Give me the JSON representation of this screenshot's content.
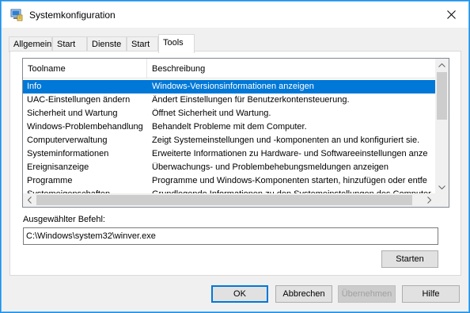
{
  "window": {
    "title": "Systemkonfiguration",
    "accent_color": "#0078d7"
  },
  "tabs": [
    {
      "label": "Allgemein"
    },
    {
      "label": "Start"
    },
    {
      "label": "Dienste"
    },
    {
      "label": "Start"
    },
    {
      "label": "Tools",
      "active": true
    }
  ],
  "tools_list": {
    "columns": [
      "Toolname",
      "Beschreibung"
    ],
    "rows": [
      {
        "name": "Info",
        "description": "Windows-Versionsinformationen anzeigen",
        "selected": true
      },
      {
        "name": "UAC-Einstellungen ändern",
        "description": "Ändert Einstellungen für Benutzerkontensteuerung."
      },
      {
        "name": "Sicherheit und Wartung",
        "description": "Öffnet Sicherheit und Wartung."
      },
      {
        "name": "Windows-Problembehandlung",
        "description": "Behandelt Probleme mit dem Computer."
      },
      {
        "name": "Computerverwaltung",
        "description": "Zeigt Systemeinstellungen und -komponenten an und konfiguriert sie."
      },
      {
        "name": "Systeminformationen",
        "description": "Erweiterte Informationen zu Hardware- und Softwareeinstellungen anze"
      },
      {
        "name": "Ereignisanzeige",
        "description": "Überwachungs- und Problembehebungsmeldungen anzeigen"
      },
      {
        "name": "Programme",
        "description": "Programme und Windows-Komponenten starten, hinzufügen oder entfe"
      },
      {
        "name": "Systemeigenschaften",
        "description": "Grundlegende Informationen zu den Systemeinstellungen des Computer"
      }
    ]
  },
  "selected_command": {
    "label": "Ausgewählter Befehl:",
    "value": "C:\\Windows\\system32\\winver.exe"
  },
  "buttons": {
    "start": "Starten",
    "ok": "OK",
    "cancel": "Abbrechen",
    "apply": "Übernehmen",
    "help": "Hilfe"
  },
  "icons": {
    "app": "msconfig-icon",
    "close": "close-icon"
  }
}
